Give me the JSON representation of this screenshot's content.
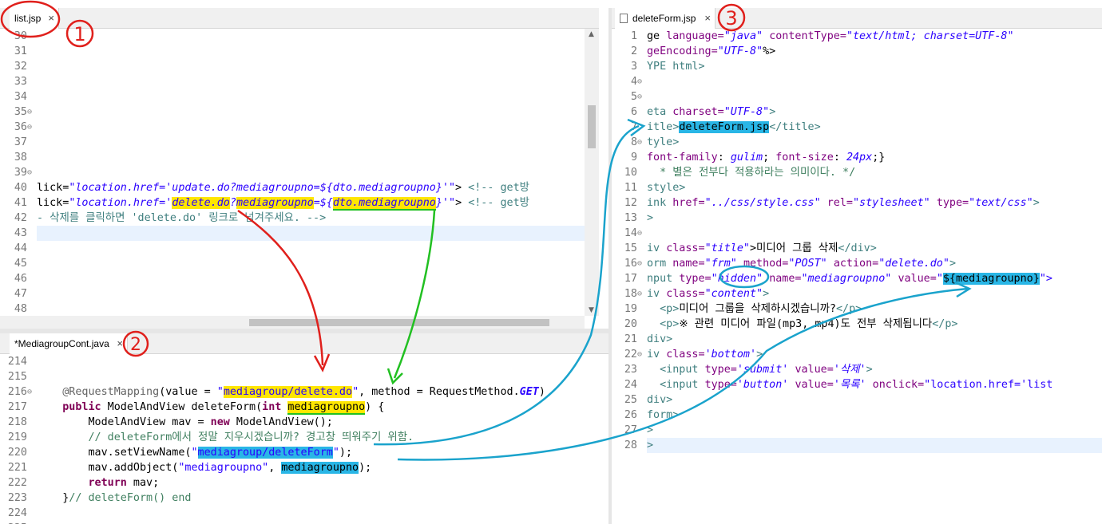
{
  "colors": {
    "yellow": "#ffe600",
    "blue": "#29b6e6",
    "green": "#22c022",
    "red": "#e0201c",
    "annot_blue": "#1aa3cc"
  },
  "annotations": [
    "1",
    "2",
    "3"
  ],
  "left_top": {
    "tab": "list.jsp",
    "lines": [
      {
        "n": "30",
        "fold": "",
        "code": ""
      },
      {
        "n": "31",
        "fold": "",
        "code": ""
      },
      {
        "n": "32",
        "fold": "",
        "code": ""
      },
      {
        "n": "33",
        "fold": "",
        "code": ""
      },
      {
        "n": "34",
        "fold": "",
        "code": ""
      },
      {
        "n": "35",
        "fold": "⊖",
        "code": ""
      },
      {
        "n": "36",
        "fold": "⊖",
        "code": ""
      },
      {
        "n": "37",
        "fold": "",
        "code": ""
      },
      {
        "n": "38",
        "fold": "",
        "code": ""
      },
      {
        "n": "39",
        "fold": "⊖",
        "code": ""
      },
      {
        "n": "40",
        "fold": "",
        "code": [
          [
            "lick=",
            ""
          ],
          [
            "\"location.href='update.do?mediagroupno=${dto.mediagroupno}'\"",
            "sti"
          ],
          [
            "> ",
            ""
          ],
          [
            "<!-- get방",
            "tg"
          ]
        ]
      },
      {
        "n": "41",
        "fold": "",
        "code": [
          [
            "lick=",
            ""
          ],
          [
            "\"location.href='",
            "sti"
          ],
          [
            "delete.do",
            "sti hy"
          ],
          [
            "?",
            "sti"
          ],
          [
            "mediagroupno",
            "sti hy"
          ],
          [
            "=${",
            "sti"
          ],
          [
            "dto.mediagroupno",
            "sti hy gu"
          ],
          [
            "}'\"",
            "sti"
          ],
          [
            "> ",
            ""
          ],
          [
            "<!-- get방",
            "tg"
          ]
        ]
      },
      {
        "n": "42",
        "fold": "",
        "code": [
          [
            "- 삭제를 클릭하면 'delete.do' 링크로 넘겨주세요. -->",
            "tg"
          ]
        ]
      },
      {
        "n": "43",
        "fold": "",
        "code": ""
      },
      {
        "n": "44",
        "fold": "",
        "code": ""
      },
      {
        "n": "45",
        "fold": "",
        "code": ""
      },
      {
        "n": "46",
        "fold": "",
        "code": ""
      },
      {
        "n": "47",
        "fold": "",
        "code": ""
      },
      {
        "n": "48",
        "fold": "",
        "code": ""
      }
    ]
  },
  "left_bottom": {
    "tab": "*MediagroupCont.java",
    "lines": [
      {
        "n": "214",
        "fold": "",
        "code": ""
      },
      {
        "n": "215",
        "fold": "",
        "code": ""
      },
      {
        "n": "216",
        "fold": "⊖",
        "code": [
          [
            "    ",
            ""
          ],
          [
            "@RequestMapping",
            "an"
          ],
          [
            "(value = ",
            ""
          ],
          [
            "\"",
            "st"
          ],
          [
            "mediagroup/delete.do",
            "st hy"
          ],
          [
            "\"",
            "st"
          ],
          [
            ", method = RequestMethod.",
            ""
          ],
          [
            "GET",
            "sti bold"
          ],
          [
            ")",
            ""
          ]
        ]
      },
      {
        "n": "217",
        "fold": "",
        "code": [
          [
            "    ",
            ""
          ],
          [
            "public",
            "kw"
          ],
          [
            " ModelAndView deleteForm(",
            ""
          ],
          [
            "int",
            "kw"
          ],
          [
            " ",
            ""
          ],
          [
            "mediagroupno",
            "hy gu"
          ],
          [
            ") {",
            ""
          ]
        ]
      },
      {
        "n": "218",
        "fold": "",
        "code": [
          [
            "        ModelAndView mav = ",
            ""
          ],
          [
            "new",
            "kw"
          ],
          [
            " ModelAndView();",
            ""
          ]
        ]
      },
      {
        "n": "219",
        "fold": "",
        "code": [
          [
            "        // deleteForm에서 정말 지우시겠습니까? 경고창 띄워주기 위함.",
            "cm"
          ]
        ]
      },
      {
        "n": "220",
        "fold": "",
        "code": [
          [
            "        mav.setViewName(",
            ""
          ],
          [
            "\"",
            "st"
          ],
          [
            "mediagroup/deleteForm",
            "st hb"
          ],
          [
            "\"",
            "st"
          ],
          [
            ");",
            ""
          ]
        ]
      },
      {
        "n": "221",
        "fold": "",
        "code": [
          [
            "        mav.addObject(",
            ""
          ],
          [
            "\"mediagroupno\"",
            "st"
          ],
          [
            ", ",
            ""
          ],
          [
            "mediagroupno",
            "hb"
          ],
          [
            ");",
            ""
          ]
        ]
      },
      {
        "n": "222",
        "fold": "",
        "code": [
          [
            "        ",
            ""
          ],
          [
            "return",
            "kw"
          ],
          [
            " mav;",
            ""
          ]
        ]
      },
      {
        "n": "223",
        "fold": "",
        "code": [
          [
            "    }",
            ""
          ],
          [
            "// deleteForm() end",
            "cm"
          ]
        ]
      },
      {
        "n": "224",
        "fold": "",
        "code": ""
      },
      {
        "n": "225",
        "fold": "",
        "code": ""
      }
    ]
  },
  "right": {
    "tab": "deleteForm.jsp",
    "lines": [
      {
        "n": "1",
        "fold": "",
        "code": [
          [
            "ge ",
            ""
          ],
          [
            "language=",
            "at"
          ],
          [
            "\"java\"",
            "sti"
          ],
          [
            " ",
            ""
          ],
          [
            "contentType=",
            "at"
          ],
          [
            "\"text/html; charset=UTF-8\"",
            "sti"
          ]
        ]
      },
      {
        "n": "2",
        "fold": "",
        "code": [
          [
            "geEncoding=",
            "at"
          ],
          [
            "\"UTF-8\"",
            "sti"
          ],
          [
            "%>",
            ""
          ]
        ]
      },
      {
        "n": "3",
        "fold": "",
        "code": [
          [
            "YPE html>",
            "tg"
          ]
        ]
      },
      {
        "n": "4",
        "fold": "⊖",
        "code": ""
      },
      {
        "n": "5",
        "fold": "⊖",
        "code": ""
      },
      {
        "n": "6",
        "fold": "",
        "code": [
          [
            "eta ",
            "tg"
          ],
          [
            "charset=",
            "at"
          ],
          [
            "\"UTF-8\"",
            "sti"
          ],
          [
            ">",
            "tg"
          ]
        ]
      },
      {
        "n": "7",
        "fold": "",
        "code": [
          [
            "itle>",
            "tg"
          ],
          [
            "deleteForm.jsp",
            "hb"
          ],
          [
            "</title>",
            "tg"
          ]
        ]
      },
      {
        "n": "8",
        "fold": "⊖",
        "code": [
          [
            "tyle>",
            "tg"
          ]
        ]
      },
      {
        "n": "9",
        "fold": "",
        "code": [
          [
            "font-family",
            "at"
          ],
          [
            ": ",
            ""
          ],
          [
            "gulim",
            "sti"
          ],
          [
            "; ",
            ""
          ],
          [
            "font-size",
            "at"
          ],
          [
            ": ",
            ""
          ],
          [
            "24px",
            "sti"
          ],
          [
            ";}",
            ""
          ]
        ]
      },
      {
        "n": "10",
        "fold": "",
        "code": [
          [
            "  * 별은 전부다 적용하라는 의미이다. */",
            "cm"
          ]
        ]
      },
      {
        "n": "11",
        "fold": "",
        "code": [
          [
            "style>",
            "tg"
          ]
        ]
      },
      {
        "n": "12",
        "fold": "",
        "code": [
          [
            "ink ",
            "tg"
          ],
          [
            "href=",
            "at"
          ],
          [
            "\"../css/style.css\"",
            "sti"
          ],
          [
            " ",
            ""
          ],
          [
            "rel=",
            "at"
          ],
          [
            "\"stylesheet\"",
            "sti"
          ],
          [
            " ",
            ""
          ],
          [
            "type=",
            "at"
          ],
          [
            "\"text/css\"",
            "sti"
          ],
          [
            ">",
            "tg"
          ]
        ]
      },
      {
        "n": "13",
        "fold": "",
        "code": [
          [
            ">",
            "tg"
          ]
        ]
      },
      {
        "n": "14",
        "fold": "⊖",
        "code": ""
      },
      {
        "n": "15",
        "fold": "",
        "code": [
          [
            "iv ",
            "tg"
          ],
          [
            "class=",
            "at"
          ],
          [
            "\"title\"",
            "sti"
          ],
          [
            ">미디어 그룹 삭제",
            ""
          ],
          [
            "</div>",
            "tg"
          ]
        ]
      },
      {
        "n": "16",
        "fold": "⊖",
        "code": [
          [
            "orm ",
            "tg"
          ],
          [
            "name=",
            "at"
          ],
          [
            "\"frm\"",
            "sti"
          ],
          [
            " ",
            ""
          ],
          [
            "method=",
            "at"
          ],
          [
            "\"POST\"",
            "sti"
          ],
          [
            " ",
            ""
          ],
          [
            "action=",
            "at"
          ],
          [
            "\"delete.do\"",
            "sti"
          ],
          [
            ">",
            "tg"
          ]
        ]
      },
      {
        "n": "17",
        "fold": "",
        "code": [
          [
            "nput ",
            "tg"
          ],
          [
            "type=",
            "at"
          ],
          [
            "\"hidden\"",
            "sti"
          ],
          [
            " ",
            ""
          ],
          [
            "name=",
            "at"
          ],
          [
            "\"mediagroupno\"",
            "sti"
          ],
          [
            " ",
            ""
          ],
          [
            "value=",
            "at"
          ],
          [
            "\"",
            "sti"
          ],
          [
            "${mediagroupno}",
            "hb"
          ],
          [
            "\">",
            "sti"
          ]
        ]
      },
      {
        "n": "18",
        "fold": "⊖",
        "code": [
          [
            "iv ",
            "tg"
          ],
          [
            "class=",
            "at"
          ],
          [
            "\"content\"",
            "sti"
          ],
          [
            ">",
            "tg"
          ]
        ]
      },
      {
        "n": "19",
        "fold": "",
        "code": [
          [
            "  <p>",
            "tg"
          ],
          [
            "미디어 그룹을 삭제하시겠습니까?",
            ""
          ],
          [
            "</p>",
            "tg"
          ]
        ]
      },
      {
        "n": "20",
        "fold": "",
        "code": [
          [
            "  <p>",
            "tg"
          ],
          [
            "※ 관련 미디어 파일(mp3, mp4)도 전부 삭제됩니다",
            ""
          ],
          [
            "</p>",
            "tg"
          ]
        ]
      },
      {
        "n": "21",
        "fold": "",
        "code": [
          [
            "div>",
            "tg"
          ]
        ]
      },
      {
        "n": "22",
        "fold": "⊖",
        "code": [
          [
            "iv ",
            "tg"
          ],
          [
            "class=",
            "at"
          ],
          [
            "'bottom'",
            "sti"
          ],
          [
            ">",
            "tg"
          ]
        ]
      },
      {
        "n": "23",
        "fold": "",
        "code": [
          [
            "  <input ",
            "tg"
          ],
          [
            "type=",
            "at"
          ],
          [
            "'submit'",
            "sti"
          ],
          [
            " ",
            ""
          ],
          [
            "value=",
            "at"
          ],
          [
            "'삭제'",
            "sti"
          ],
          [
            ">",
            "tg"
          ]
        ]
      },
      {
        "n": "24",
        "fold": "",
        "code": [
          [
            "  <input ",
            "tg"
          ],
          [
            "type=",
            "at"
          ],
          [
            "'button'",
            "sti"
          ],
          [
            " ",
            ""
          ],
          [
            "value=",
            "at"
          ],
          [
            "'목록'",
            "sti"
          ],
          [
            " ",
            ""
          ],
          [
            "onclick=",
            "at"
          ],
          [
            "\"location.href='list",
            "st"
          ]
        ]
      },
      {
        "n": "25",
        "fold": "",
        "code": [
          [
            "div>",
            "tg"
          ]
        ]
      },
      {
        "n": "26",
        "fold": "",
        "code": [
          [
            "form>",
            "tg"
          ]
        ]
      },
      {
        "n": "27",
        "fold": "",
        "code": [
          [
            ">",
            "tg"
          ]
        ]
      },
      {
        "n": "28",
        "fold": "",
        "code": [
          [
            ">",
            "tg"
          ]
        ]
      }
    ]
  }
}
